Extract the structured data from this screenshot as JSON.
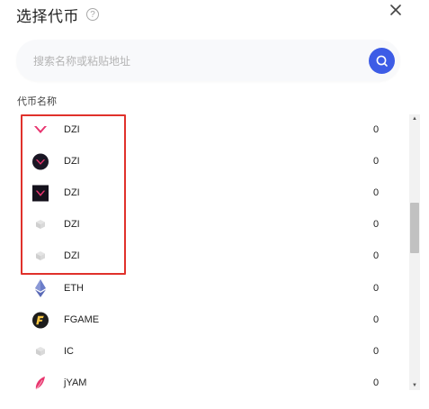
{
  "header": {
    "title": "选择代币",
    "help_glyph": "?"
  },
  "search": {
    "placeholder": "搜索名称或粘贴地址",
    "value": ""
  },
  "section": {
    "label": "代币名称"
  },
  "tokens": [
    {
      "name": "DZI",
      "amount": "0",
      "icon": "dzi-pink-logo"
    },
    {
      "name": "DZI",
      "amount": "0",
      "icon": "dzi-dark-circle-logo"
    },
    {
      "name": "DZI",
      "amount": "0",
      "icon": "dzi-dark-square-logo"
    },
    {
      "name": "DZI",
      "amount": "0",
      "icon": "placeholder-token-icon"
    },
    {
      "name": "DZI",
      "amount": "0",
      "icon": "placeholder-token-icon"
    },
    {
      "name": "ETH",
      "amount": "0",
      "icon": "ethereum-icon"
    },
    {
      "name": "FGAME",
      "amount": "0",
      "icon": "fgame-icon"
    },
    {
      "name": "IC",
      "amount": "0",
      "icon": "placeholder-token-icon"
    },
    {
      "name": "jYAM",
      "amount": "0",
      "icon": "jyam-icon"
    }
  ],
  "colors": {
    "accent": "#3d5ce6",
    "highlight": "#e0312b",
    "dzi_pink": "#e8336e"
  }
}
